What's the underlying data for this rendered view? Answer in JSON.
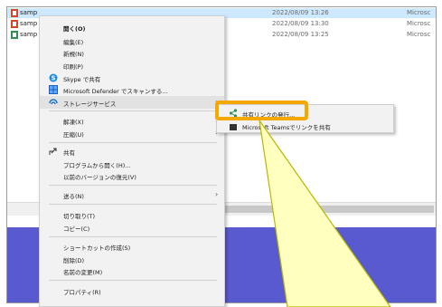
{
  "files": [
    {
      "name": "samp",
      "date": "2022/08/09 13:26",
      "type": "Microsc"
    },
    {
      "name": "samp",
      "date": "2022/08/09 13:30",
      "type": "Microsc"
    },
    {
      "name": "samp",
      "date": "2022/08/09 13:25",
      "type": "Microsc"
    }
  ],
  "context_menu": {
    "open": "開く(O)",
    "edit": "編集(E)",
    "new": "新規(N)",
    "print": "印刷(P)",
    "skype_share": "Skype で共有",
    "defender_scan": "Microsoft Defender でスキャンする...",
    "storage_service": "ストレージサービス",
    "extract": "解凍(X)",
    "compress": "圧縮(U)",
    "share": "共有",
    "open_with": "プログラムから開く(H)...",
    "restore_previous": "以前のバージョンの復元(V)",
    "send_to": "送る(N)",
    "cut": "切り取り(T)",
    "copy": "コピー(C)",
    "create_shortcut": "ショートカットの作成(S)",
    "delete": "削除(D)",
    "rename": "名前の変更(M)",
    "properties": "プロパティ(R)"
  },
  "submenu": {
    "share_link": "共有リンクの発行...",
    "second_item": "Microsoft Teamsでリンクを共有"
  },
  "colors": {
    "highlight": "#f5a800",
    "callout_fill": "#ffffc0",
    "desktop": "#5a5ad0",
    "selected_row": "#cde8ff"
  },
  "icons": {
    "file": "powerpoint-file-icon",
    "skype": "skype-icon",
    "defender": "defender-icon",
    "storage": "storage-service-icon",
    "share": "share-icon",
    "share_link": "share-link-icon"
  }
}
